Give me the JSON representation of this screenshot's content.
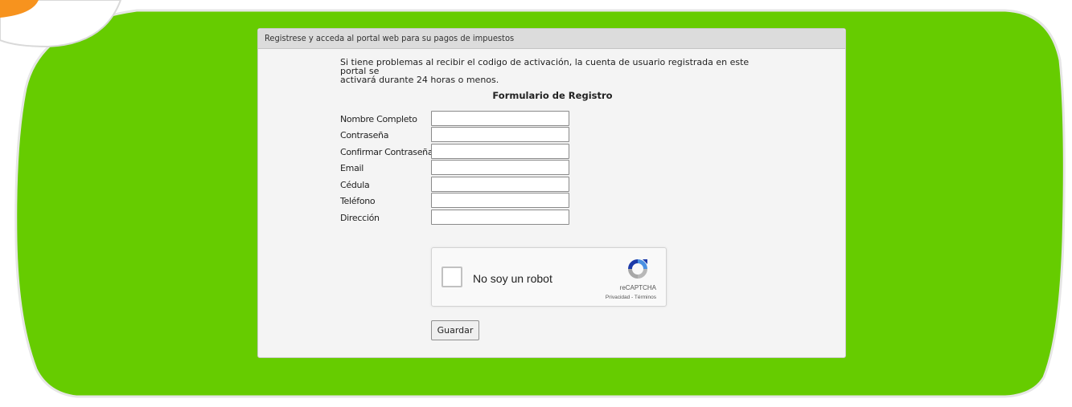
{
  "colors": {
    "accent_green": "#66cc00",
    "accent_orange": "#f7931e",
    "panel_bg": "#f4f4f4"
  },
  "panel": {
    "header": "Registrese y acceda al portal web para su pagos de impuestos",
    "notice_line1": "Si tiene problemas al recibir el codigo de activación, la cuenta de usuario registrada en este portal se",
    "notice_line2": "activará durante 24 horas o menos.",
    "form_title": "Formulario de Registro"
  },
  "form": {
    "fields": [
      {
        "label": "Nombre Completo",
        "value": ""
      },
      {
        "label": "Contraseña",
        "value": ""
      },
      {
        "label": "Confirmar Contraseña",
        "value": ""
      },
      {
        "label": "Email",
        "value": ""
      },
      {
        "label": "Cédula",
        "value": ""
      },
      {
        "label": "Teléfono",
        "value": ""
      },
      {
        "label": "Dirección",
        "value": ""
      }
    ],
    "save_label": "Guardar"
  },
  "captcha": {
    "checkbox_label": "No soy un robot",
    "brand": "reCAPTCHA",
    "links": "Privacidad - Términos",
    "icon": "recaptcha-icon"
  }
}
